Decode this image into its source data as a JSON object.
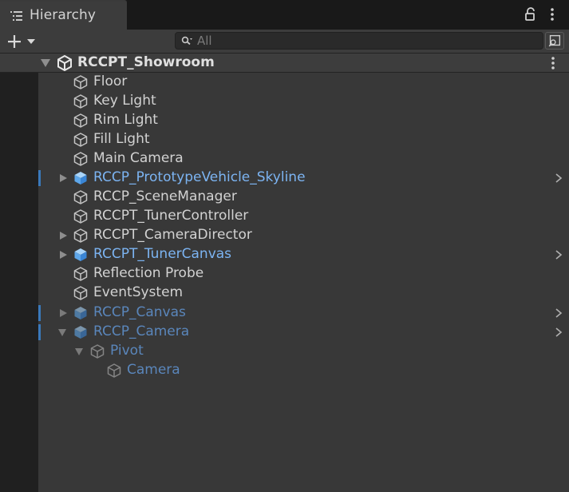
{
  "tab": {
    "title": "Hierarchy",
    "icon": "hierarchy-list-icon"
  },
  "header_icons": [
    "lock-icon",
    "kebab-menu-icon"
  ],
  "toolbar": {
    "create_icon": "plus-dropdown-icon",
    "search": {
      "placeholder": "All",
      "value": ""
    },
    "search_mode_icon": "search-mode-toggle-icon"
  },
  "scene": {
    "name": "RCCPT_Showroom",
    "icon": "unity-scene-icon",
    "expanded": true
  },
  "items": [
    {
      "label": "Floor"
    },
    {
      "label": "Key Light"
    },
    {
      "label": "Rim Light"
    },
    {
      "label": "Fill Light"
    },
    {
      "label": "Main Camera"
    },
    {
      "label": "RCCP_PrototypeVehicle_Skyline"
    },
    {
      "label": "RCCP_SceneManager"
    },
    {
      "label": "RCCPT_TunerController"
    },
    {
      "label": "RCCPT_CameraDirector"
    },
    {
      "label": "RCCPT_TunerCanvas"
    },
    {
      "label": "Reflection Probe"
    },
    {
      "label": "EventSystem"
    },
    {
      "label": "RCCP_Canvas"
    },
    {
      "label": "RCCP_Camera"
    },
    {
      "label": "Pivot"
    },
    {
      "label": "Camera"
    }
  ],
  "colors": {
    "prefab_text": "#7cb4f2",
    "prefab_inactive_text": "#5a86bb",
    "accent_bar": "#3a79bb",
    "text": "#d2d2d2",
    "background": "#383838"
  }
}
